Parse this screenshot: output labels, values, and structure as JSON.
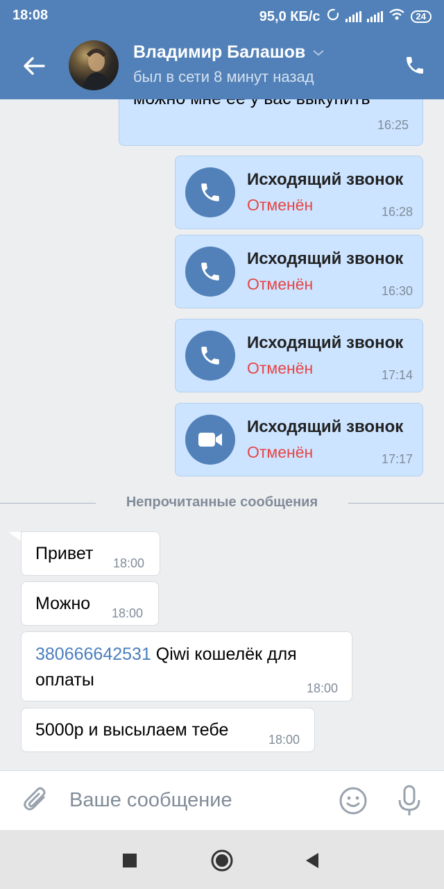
{
  "status_bar": {
    "time": "18:08",
    "network_speed": "95,0 КБ/с",
    "battery": "24"
  },
  "header": {
    "contact_name": "Владимир Балашов",
    "contact_status": "был в сети 8 минут назад"
  },
  "messages": {
    "partial": {
      "text": "можно мне ее у вас выкупить",
      "time": "16:25"
    },
    "calls": [
      {
        "title": "Исходящий звонок",
        "state": "Отменён",
        "time": "16:28",
        "kind": "phone"
      },
      {
        "title": "Исходящий звонок",
        "state": "Отменён",
        "time": "16:30",
        "kind": "phone"
      },
      {
        "title": "Исходящий звонок",
        "state": "Отменён",
        "time": "17:14",
        "kind": "phone"
      },
      {
        "title": "Исходящий звонок",
        "state": "Отменён",
        "time": "17:17",
        "kind": "video"
      }
    ],
    "unread_divider": "Непрочитанные сообщения",
    "incoming": [
      {
        "text": "Привет",
        "time": "18:00"
      },
      {
        "text": "Можно",
        "time": "18:00"
      },
      {
        "link": "380666642531",
        "text_rest": " Qiwi кошелёк для",
        "text_line2": "оплаты",
        "time": "18:00"
      },
      {
        "text": "5000р и высылаем тебе",
        "time": "18:00"
      }
    ]
  },
  "input": {
    "placeholder": "Ваше сообщение"
  },
  "colors": {
    "header_bg": "#5181b8",
    "outgoing_bubble": "#cce4ff",
    "cancelled": "#e64646",
    "link": "#4a7fbd"
  },
  "icons": {
    "back": "arrow-left-icon",
    "call": "phone-icon",
    "attach": "paperclip-icon",
    "emoji": "smile-icon",
    "mic": "microphone-icon",
    "nav": [
      "square-icon",
      "circle-icon",
      "triangle-icon"
    ]
  }
}
